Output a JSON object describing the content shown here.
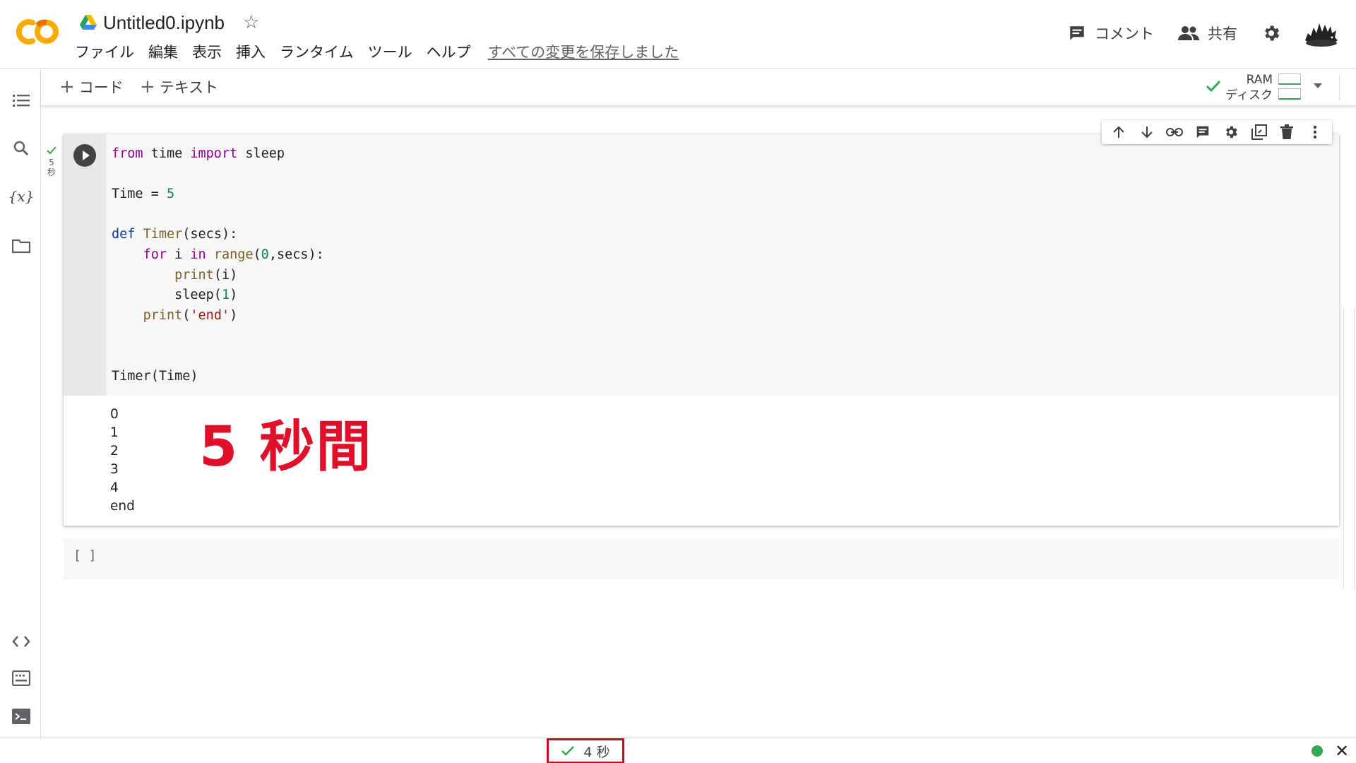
{
  "header": {
    "title": "Untitled0.ipynb",
    "menu": [
      "ファイル",
      "編集",
      "表示",
      "挿入",
      "ランタイム",
      "ツール",
      "ヘルプ"
    ],
    "save_status": "すべての変更を保存しました",
    "comment_label": "コメント",
    "share_label": "共有"
  },
  "toolbar": {
    "add_code": "コード",
    "add_text": "テキスト",
    "ram_label": "RAM",
    "disk_label": "ディスク"
  },
  "cell": {
    "exec_time_value": "5",
    "exec_time_unit": "秒",
    "code_lines": [
      "from time import sleep",
      "",
      "Time = 5",
      "",
      "def Timer(secs):",
      "    for i in range(0,secs):",
      "        print(i)",
      "        sleep(1)",
      "    print('end')",
      "",
      "",
      "Timer(Time)"
    ],
    "output_lines": [
      "0",
      "1",
      "2",
      "3",
      "4",
      "end"
    ],
    "annotation": "5 秒間"
  },
  "empty_cell": {
    "prompt": "[ ]"
  },
  "statusbar": {
    "duration": "4 秒"
  },
  "icons": {
    "sidebar": [
      "toc-icon",
      "search-icon",
      "variables-icon",
      "folder-icon",
      "code-snippets-icon",
      "command-palette-icon",
      "terminal-icon"
    ],
    "cell_toolbar": [
      "move-up-icon",
      "move-down-icon",
      "link-icon",
      "comment-icon",
      "settings-icon",
      "mirror-cell-icon",
      "delete-icon",
      "more-icon"
    ]
  },
  "colors": {
    "accent_orange": "#f9ab00",
    "annotation_red": "#e0102a",
    "status_green": "#34a853",
    "highlight_box": "#d0021b"
  }
}
